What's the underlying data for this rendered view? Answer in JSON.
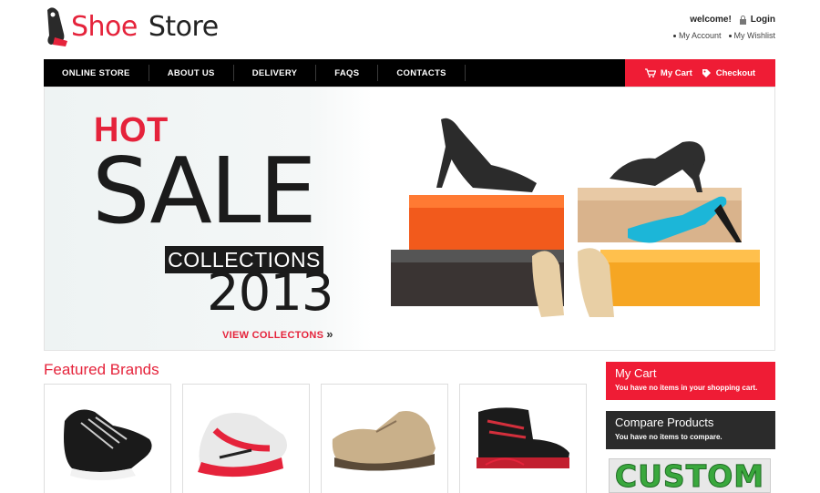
{
  "header": {
    "logo_shoe": "Shoe",
    "logo_store": "Store",
    "welcome": "welcome!",
    "login": "Login",
    "my_account": "My Account",
    "my_wishlist": "My Wishlist"
  },
  "nav": {
    "items": [
      "ONLINE STORE",
      "ABOUT US",
      "DELIVERY",
      "FAQS",
      "CONTACTS"
    ],
    "my_cart": "My Cart",
    "checkout": "Checkout"
  },
  "banner": {
    "hot": "HOT",
    "sale": "SALE",
    "collections": "COLLECTIONS",
    "year": "2013",
    "view_link": "VIEW COLLECTONS",
    "view_arrow": "»"
  },
  "featured": {
    "title": "Featured Brands"
  },
  "sidebar": {
    "cart_title": "My Cart",
    "cart_text": "You have no items in your shopping cart.",
    "compare_title": "Compare Products",
    "compare_text": "You have no items to compare.",
    "custom_label": "CUSTOM"
  },
  "colors": {
    "accent": "#ef1c35",
    "nav_bg": "#000000",
    "compare_bg": "#2b2b2b"
  }
}
